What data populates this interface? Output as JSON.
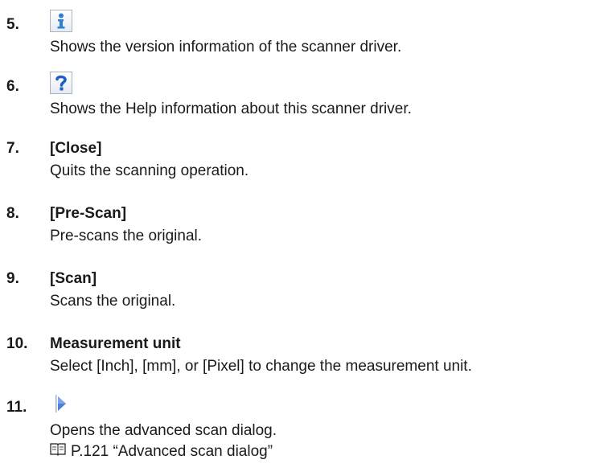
{
  "items": [
    {
      "number": "5.",
      "icon": "info-icon",
      "description": "Shows the version information of the scanner driver."
    },
    {
      "number": "6.",
      "icon": "help-icon",
      "description": "Shows the Help information about this scanner driver."
    },
    {
      "number": "7.",
      "heading": "[Close]",
      "description": "Quits the scanning operation."
    },
    {
      "number": "8.",
      "heading": "[Pre-Scan]",
      "description": "Pre-scans the original."
    },
    {
      "number": "9.",
      "heading": "[Scan]",
      "description": "Scans the original."
    },
    {
      "number": "10.",
      "heading": "Measurement unit",
      "description": "Select [Inch], [mm], or [Pixel] to change the measurement unit."
    },
    {
      "number": "11.",
      "icon": "expand-arrow-icon",
      "description": "Opens the advanced scan dialog.",
      "reference": "P.121 “Advanced scan dialog”",
      "reference_icon": "book-icon"
    }
  ],
  "colors": {
    "text": "#1a1a1a",
    "info_blue": "#2f7fd6",
    "help_blue": "#1f5fc4",
    "arrow_blue": "#4a7fdc"
  }
}
